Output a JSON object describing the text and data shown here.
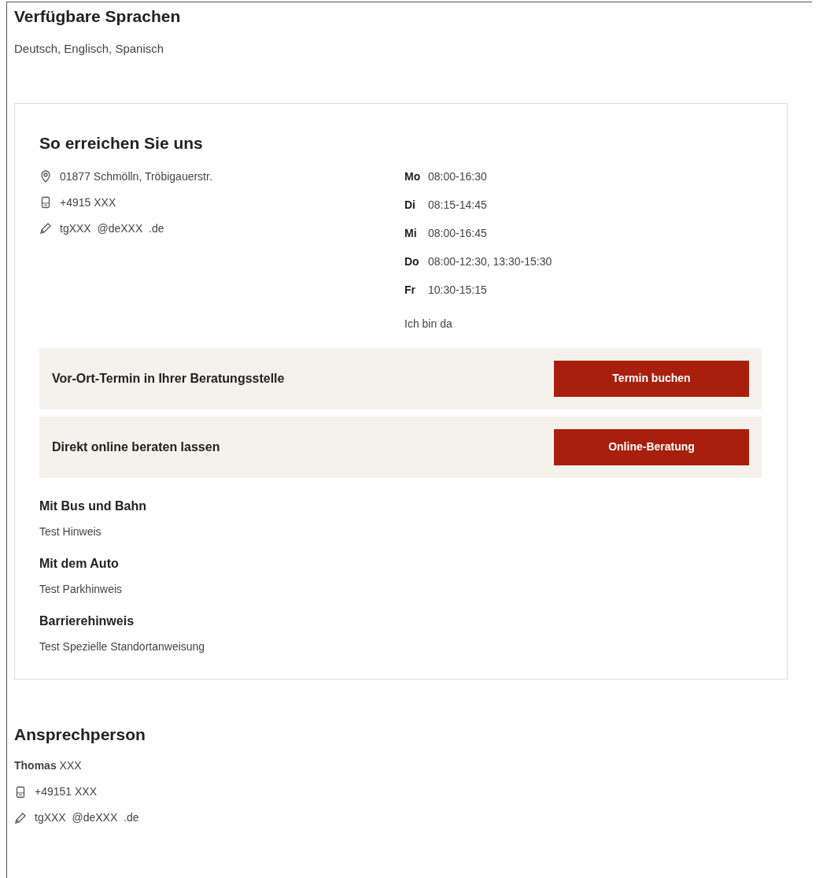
{
  "languages": {
    "title": "Verfügbare Sprachen",
    "text": "Deutsch, Englisch, Spanisch"
  },
  "contact_card": {
    "title": "So erreichen Sie uns",
    "contacts": [
      {
        "kind": "address",
        "text": "01877 Schmölln, Tröbigauerstr."
      },
      {
        "kind": "phone",
        "text": "+4915 XXX"
      },
      {
        "kind": "email",
        "text": "tgXXX  @deXXX  .de"
      }
    ],
    "hours": [
      {
        "day": "Mo",
        "time": "08:00-16:30"
      },
      {
        "day": "Di",
        "time": "08:15-14:45"
      },
      {
        "day": "Mi",
        "time": "08:00-16:45"
      },
      {
        "day": "Do",
        "time": "08:00-12:30, 13:30-15:30"
      },
      {
        "day": "Fr",
        "time": "10:30-15:15"
      }
    ],
    "hours_note": "Ich bin da",
    "actions": [
      {
        "label": "Vor-Ort-Termin in Ihrer Beratungsstelle",
        "button": "Termin buchen"
      },
      {
        "label": "Direkt online beraten lassen",
        "button": "Online-Beratung"
      }
    ],
    "directions": [
      {
        "title": "Mit Bus und Bahn",
        "text": "Test Hinweis"
      },
      {
        "title": "Mit dem Auto",
        "text": "Test Parkhinweis"
      },
      {
        "title": "Barrierehinweis",
        "text": "Test Spezielle Standortanweisung"
      }
    ]
  },
  "contact_person": {
    "title": "Ansprechperson",
    "name": "**Thomas** XXX",
    "contacts": [
      {
        "kind": "phone",
        "text": "+49151 XXX"
      },
      {
        "kind": "email",
        "text": "tgXXX  @deXXX  .de"
      }
    ]
  }
}
